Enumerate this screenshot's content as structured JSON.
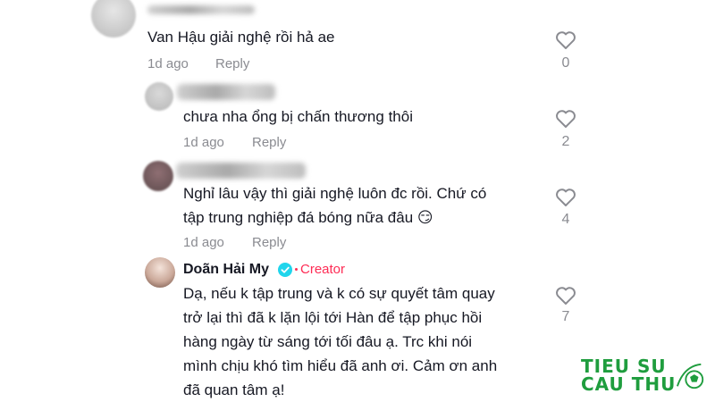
{
  "comments": [
    {
      "text": "Van Hậu giải nghệ rồi hả ae",
      "time": "1d ago",
      "reply_label": "Reply",
      "likes": "0"
    },
    {
      "text": "chưa nha ổng bị chấn thương thôi",
      "time": "1d ago",
      "reply_label": "Reply",
      "likes": "2"
    },
    {
      "text_line1": "Nghỉ lâu vậy thì giải nghệ luôn đc rồi. Chứ có",
      "text_line2": "tập trung nghiệp đá bóng nữa đâu 😏",
      "time": "1d ago",
      "reply_label": "Reply",
      "likes": "4"
    },
    {
      "author": "Doãn Hải My",
      "badge": "Creator",
      "text_line1": "Dạ, nếu k tập trung và k có sự quyết tâm quay",
      "text_line2": "trở lại thì đã k lặn lội tới Hàn để tập phục hồi",
      "text_line3": "hàng ngày từ sáng tới tối đâu ạ. Trc khi nói",
      "text_line4": "mình chịu khó tìm hiểu đã anh ơi. Cảm ơn anh",
      "text_line5": "đã quan tâm ạ!",
      "likes": "7"
    }
  ],
  "watermark": {
    "line1": "TIEU SU",
    "line2": "CAU THU"
  },
  "colors": {
    "accent": "#fe2c55",
    "verified": "#20d5ec",
    "muted": "#8a8b91",
    "watermark": "#1f9d3e"
  }
}
